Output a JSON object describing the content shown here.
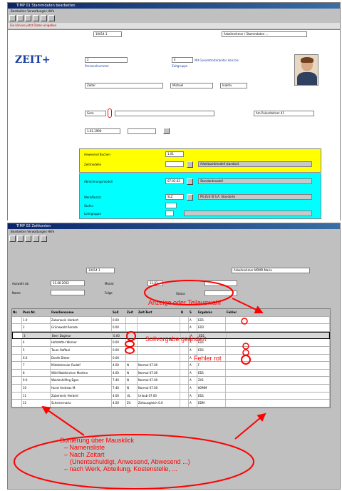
{
  "top_window": {
    "title": "TIMP 01  Stammdaten bearbeiten",
    "menu": "Bearbeiten  Verwaltungen  Hilfe",
    "status": "Sie können jetzt Daten eingeben",
    "nav_field": "10014 1",
    "right_field": "Arbeitnehmer / Stammdaten ...",
    "logo": "ZEIT+",
    "id_value": "2",
    "id_label": "Personalnummer",
    "id2_value": "4",
    "id2_text": "Mit Gesamtmitarbeiter deis bis",
    "id2_label": "Zeitgruppe",
    "last_name": "Zeiter",
    "first_name": "Michael",
    "title_field": "Inaktiv",
    "address_left": "Gern",
    "address_right": "Am Pulverbohrer 41",
    "date_value": "1.01.1990",
    "yellow_rows": [
      {
        "label": "Anwesend Buchen",
        "value": "1.01"
      },
      {
        "label": "Zeitmodelle",
        "value": "",
        "desc": "Arbeitszeitmodell standard"
      }
    ],
    "cyan_rows": [
      {
        "label": "Abrechnungsmodell",
        "value": "07.03.02",
        "desc": "Standardmodell"
      },
      {
        "label": "Werk/Kostst.",
        "value": "SLZ",
        "desc": "PS-Zeit III S.A. Standorte"
      },
      {
        "label": "Stufen",
        "value": ""
      },
      {
        "label": "Lohngruppe",
        "value": ""
      }
    ]
  },
  "bottom_window": {
    "title": "TIMP 02  Zeitkonten",
    "menu": "Bearbeiten  Verwaltungen  Hilfe",
    "nav_field": "10014 1",
    "right_field": "Arbeitnehmer MRMR-Maria",
    "filter_labels": {
      "from": "Auswahl ab",
      "name": "Name",
      "period": "Monat",
      "to": "Folge",
      "status": "Status"
    },
    "filter_values": {
      "from": "31.08.2002",
      "period": "11.01"
    },
    "columns": [
      "Nr.",
      "Pers.Nr.",
      "Familienname",
      "Soll",
      "Zeit",
      "Zeit-Text",
      "B",
      "S",
      "Ergebnis",
      "Fehler"
    ],
    "rows": [
      [
        "",
        "1.0",
        "Zuberwein Herbert",
        "0.00",
        "",
        "",
        "",
        "A",
        "ED1",
        ""
      ],
      [
        "",
        "2",
        "Grünewald Renate",
        "0.00",
        "",
        "",
        "",
        "A",
        "ED2",
        ""
      ],
      [
        "",
        "3",
        "Beer Dagmar",
        "0.00",
        "",
        "",
        "",
        "A",
        "ED1",
        ""
      ],
      [
        "",
        "4",
        "Hofstetter Werner",
        "0.00",
        "",
        "",
        "",
        "A",
        "ED1",
        ""
      ],
      [
        "",
        "5",
        "Tauer Raffael",
        "0.00",
        "",
        "",
        "",
        "A",
        "ED1",
        ""
      ],
      [
        "",
        "6.0",
        "Donth Dieter",
        "0.00",
        "",
        "",
        "",
        "A",
        "",
        ""
      ],
      [
        "",
        "7",
        "Middelsmaier Rudolf",
        "4.00",
        "N",
        "Normal 07.00",
        "",
        "A",
        "F",
        ""
      ],
      [
        "",
        "8",
        "Wild Waldkirchen Martina",
        "4.00",
        "N",
        "Normal 07.00",
        "",
        "A",
        "ED1",
        ""
      ],
      [
        "",
        "9.0",
        "Weidenhilfing Egon",
        "7.40",
        "N",
        "Normal 07.00",
        "",
        "A",
        "ZA1",
        ""
      ],
      [
        "",
        "10",
        "Hurst Andreas M.",
        "7.40",
        "N",
        "Normal 07.00",
        "",
        "A",
        "KOMM",
        ""
      ],
      [
        "",
        "11",
        "Zuberwein Herbert",
        "4.00",
        "UL",
        "Urlaub 07.00",
        "",
        "A",
        "ED1",
        ""
      ],
      [
        "",
        "12",
        "Scheinernaria",
        "4.00",
        "ZA",
        "Zeitausgleich 0.0",
        "",
        "A",
        "EDM",
        ""
      ]
    ]
  },
  "annotations": {
    "select": "Anzeige oder Teilauswahl",
    "soll": "Sollvorgabe geändert",
    "error": "Fehler rot",
    "sort_title": "Sortierung über Mausklick",
    "sort_1": "– Namensliste",
    "sort_2": "– Nach Zeitart",
    "sort_3": "(Unentschuldigt, Anwesend, Abwesend ...)",
    "sort_4": "– nach Werk, Abteilung, Kostenstelle, ..."
  },
  "colors": {
    "annotation": "#ff0000",
    "highlight_yellow": "#ffff00",
    "highlight_cyan": "#00ffff"
  }
}
